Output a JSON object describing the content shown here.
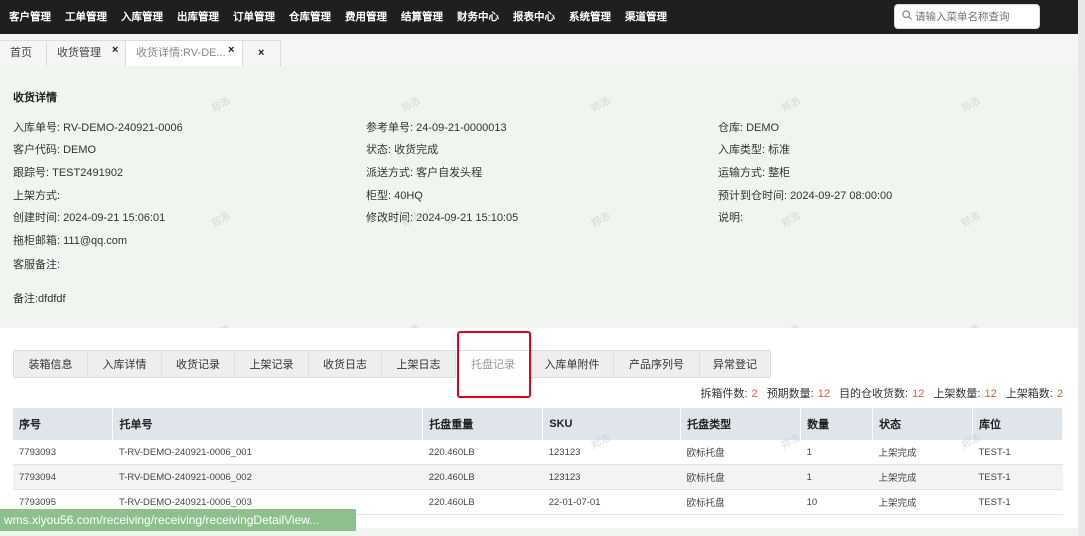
{
  "nav": {
    "menu": [
      "客户管理",
      "工单管理",
      "入库管理",
      "出库管理",
      "订单管理",
      "仓库管理",
      "费用管理",
      "结算管理",
      "财务中心",
      "报表中心",
      "系统管理",
      "渠道管理"
    ],
    "search_placeholder": "请输入菜单名称查询"
  },
  "tabs": [
    {
      "label": "首页"
    },
    {
      "label": "收货管理",
      "close": "×"
    },
    {
      "label": "收货详情:RV-DE...",
      "close": "×"
    },
    {
      "label": "",
      "close": "×"
    }
  ],
  "detail": {
    "title": "收货详情",
    "col1": [
      "入库单号: RV-DEMO-240921-0006",
      "客户代码: DEMO",
      "跟踪号: TEST2491902",
      "上架方式:",
      "创建时间: 2024-09-21 15:06:01",
      "拖柜邮箱: 111@qq.com",
      "客服备注:",
      "备注:dfdfdf"
    ],
    "col2": [
      "参考单号: 24-09-21-0000013",
      "状态: 收货完成",
      "派送方式: 客户自发头程",
      "柜型: 40HQ",
      "修改时间: 2024-09-21 15:10:05"
    ],
    "col3": [
      "仓库: DEMO",
      "入库类型: 标准",
      "运输方式: 整柜",
      "预计到仓时间: 2024-09-27 08:00:00",
      "说明:"
    ]
  },
  "watermark_text": "郑浩",
  "subtabs": [
    "装箱信息",
    "入库详情",
    "收货记录",
    "上架记录",
    "收货日志",
    "上架日志",
    "托盘记录",
    "入库单附件",
    "产品序列号",
    "异常登记"
  ],
  "active_subtab": 6,
  "stats": [
    {
      "label": "拆箱件数:",
      "value": "2"
    },
    {
      "label": "预期数量:",
      "value": "12"
    },
    {
      "label": "目的仓收货数:",
      "value": "12"
    },
    {
      "label": "上架数量:",
      "value": "12"
    },
    {
      "label": "上架箱数:",
      "value": "2"
    }
  ],
  "table": {
    "headers": [
      "序号",
      "托单号",
      "托盘重量",
      "SKU",
      "托盘类型",
      "数量",
      "状态",
      "库位"
    ],
    "rows": [
      [
        "7793093",
        "T-RV-DEMO-240921-0006_001",
        "220.460LB",
        "123123",
        "欧标托盘",
        "1",
        "上架完成",
        "TEST-1"
      ],
      [
        "7793094",
        "T-RV-DEMO-240921-0006_002",
        "220.460LB",
        "123123",
        "欧标托盘",
        "1",
        "上架完成",
        "TEST-1"
      ],
      [
        "7793095",
        "T-RV-DEMO-240921-0006_003",
        "220.460LB",
        "22-01-07-01",
        "欧标托盘",
        "10",
        "上架完成",
        "TEST-1"
      ]
    ]
  },
  "status_url": "wms.xiyou56.com/receiving/receiving/receivingDetailView..."
}
